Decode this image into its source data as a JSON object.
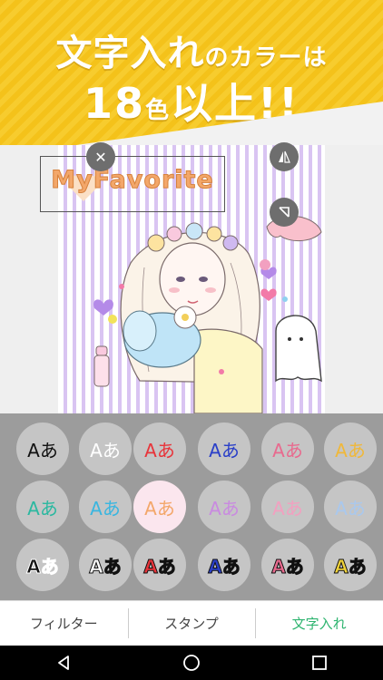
{
  "promo": {
    "line1_main": "文字入れ",
    "line1_small": "のカラーは",
    "line2_num": "18",
    "line2_small": "色",
    "line2_end": "以上!!"
  },
  "editor": {
    "text": "MyFavorite",
    "text_color": "#f3a76a"
  },
  "palette": {
    "label": "Aあ",
    "rows": [
      [
        {
          "color": "#111111",
          "style": "plain"
        },
        {
          "color": "#ffffff",
          "style": "plain"
        },
        {
          "color": "#e8343a",
          "style": "plain"
        },
        {
          "color": "#2a3fc8",
          "style": "plain"
        },
        {
          "color": "#e86a8e",
          "style": "plain"
        },
        {
          "color": "#f0b83a",
          "style": "plain"
        }
      ],
      [
        {
          "color": "#2bb8a0",
          "style": "plain"
        },
        {
          "color": "#39b6e0",
          "style": "plain"
        },
        {
          "color": "#f3a76a",
          "style": "plain",
          "active": true
        },
        {
          "color": "#c98ae0",
          "style": "plain"
        },
        {
          "color": "#f2a0c0",
          "style": "plain"
        },
        {
          "color": "#a9c8ee",
          "style": "plain"
        }
      ],
      [
        {
          "color": "#111111",
          "style": "bold",
          "outline": "#ffffff"
        },
        {
          "color": "#ffffff",
          "style": "bold",
          "outline": "#111111"
        },
        {
          "color": "#e8343a",
          "style": "bold",
          "outline": "#111111"
        },
        {
          "color": "#2a3fc8",
          "style": "bold",
          "outline": "#111111"
        },
        {
          "color": "#e86a8e",
          "style": "bold",
          "outline": "#111111"
        },
        {
          "color": "#f0d23a",
          "style": "bold",
          "outline": "#111111"
        }
      ]
    ]
  },
  "tabs": [
    {
      "label": "フィルター",
      "active": false
    },
    {
      "label": "スタンプ",
      "active": false
    },
    {
      "label": "文字入れ",
      "active": true
    }
  ],
  "nav": {
    "back_icon": "back-icon",
    "home_icon": "home-icon",
    "recents_icon": "recents-icon"
  }
}
